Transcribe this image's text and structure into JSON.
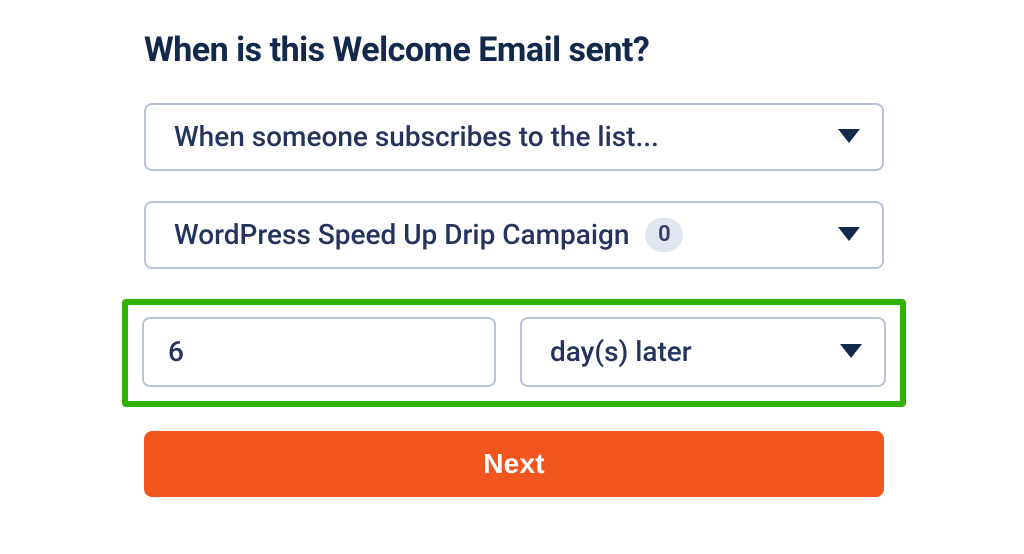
{
  "heading": "When is this Welcome Email sent?",
  "trigger_select": {
    "selected_label": "When someone subscribes to the list..."
  },
  "list_select": {
    "selected_label": "WordPress Speed Up Drip Campaign",
    "count_badge": "0"
  },
  "delay": {
    "value": "6",
    "unit_label": "day(s) later"
  },
  "next_button_label": "Next",
  "colors": {
    "text_navy": "#13294b",
    "field_text": "#25345f",
    "field_border": "#b9c3d8",
    "highlight_green": "#2fb200",
    "btn_orange": "#f0561e",
    "badge_bg": "#e2e6f0"
  }
}
